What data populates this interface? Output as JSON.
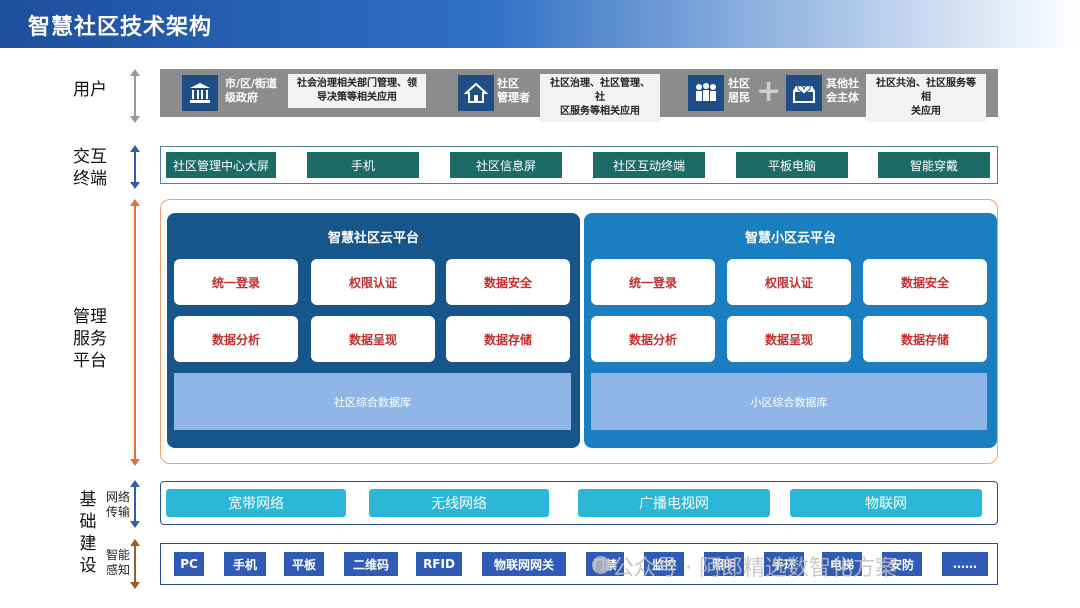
{
  "title": "智慧社区技术架构",
  "labels": {
    "user": "用户",
    "terminal_1": "交互",
    "terminal_2": "终端",
    "platform_1": "管理",
    "platform_2": "服务",
    "platform_3": "平台",
    "base_1": "基",
    "base_2": "础",
    "base_3": "建",
    "base_4": "设",
    "network_1": "网络",
    "network_2": "传输",
    "sensing_1": "智能",
    "sensing_2": "感知"
  },
  "users": [
    {
      "icon": "government-building-icon",
      "label_1": "市/区/街道",
      "label_2": "级政府",
      "desc_1": "社会治理相关部门管理、领",
      "desc_2": "导决策等相关应用"
    },
    {
      "icon": "home-icon",
      "label_1": "社区",
      "label_2": "管理者",
      "desc_1": "社区治理、社区管理、社",
      "desc_2": "区服务等相关应用"
    },
    {
      "icon": "people-group-icon",
      "label_1": "社区",
      "label_2": "居民",
      "plus": "+"
    },
    {
      "icon": "shop-heart-icon",
      "label_1": "其他社",
      "label_2": "会主体",
      "desc_1": "社区共治、社区服务等相",
      "desc_2": "关应用"
    }
  ],
  "terminals": [
    "社区管理中心大屏",
    "手机",
    "社区信息屏",
    "社区互动终端",
    "平板电脑",
    "智能穿戴"
  ],
  "platforms": [
    {
      "title": "智慧社区云平台",
      "color": "#17568a",
      "services": [
        "统一登录",
        "权限认证",
        "数据安全",
        "数据分析",
        "数据呈现",
        "数据存储"
      ],
      "database": "社区综合数据库"
    },
    {
      "title": "智慧小区云平台",
      "color": "#1a7fc0",
      "services": [
        "统一登录",
        "权限认证",
        "数据安全",
        "数据分析",
        "数据呈现",
        "数据存储"
      ],
      "database": "小区综合数据库"
    }
  ],
  "networks": [
    "宽带网络",
    "无线网络",
    "广播电视网",
    "物联网"
  ],
  "sensing": [
    "PC",
    "手机",
    "平板",
    "二维码",
    "RFID",
    "物联网网关",
    "门禁",
    "监控",
    "照明",
    "手环",
    "电梯",
    "安防",
    "……"
  ],
  "watermark": "公众号 · 阿郎精选数智化方案"
}
